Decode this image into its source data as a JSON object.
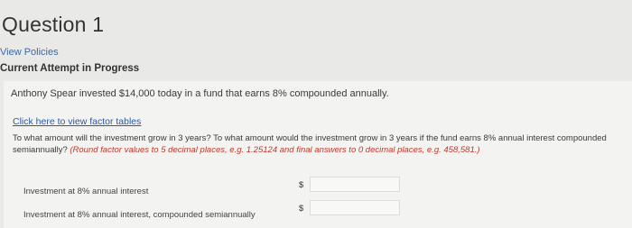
{
  "header": {
    "title": "Question 1",
    "view_policies": "View Policies",
    "attempt_status": "Current Attempt in Progress"
  },
  "question": {
    "prompt": "Anthony Spear invested $14,000 today in a fund that earns 8% compounded annually.",
    "factor_link": "Click here to view factor tables",
    "instruction": "To what amount will the investment grow in 3 years? To what amount would the investment grow in 3 years if the fund earns 8% annual interest compounded semiannually?",
    "hint": "(Round factor values to 5 decimal places, e.g. 1.25124 and final answers to 0 decimal places, e.g. 458,581.)"
  },
  "answers": [
    {
      "label": "Investment at 8% annual interest",
      "currency": "$",
      "value": ""
    },
    {
      "label": "Investment at 8% annual interest, compounded semiannually",
      "currency": "$",
      "value": ""
    }
  ]
}
